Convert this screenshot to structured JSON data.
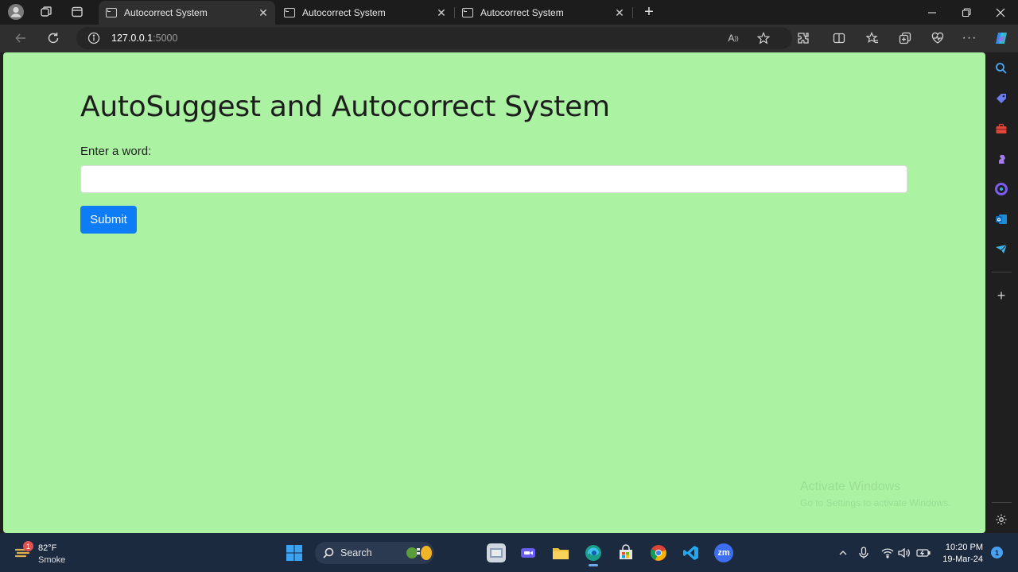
{
  "browser": {
    "tabs": [
      {
        "title": "Autocorrect System",
        "active": true
      },
      {
        "title": "Autocorrect System",
        "active": false
      },
      {
        "title": "Autocorrect System",
        "active": false
      }
    ],
    "url": {
      "host": "127.0.0.1",
      "port": ":5000"
    },
    "colors": {
      "tabbar": "#1c1c1c",
      "toolbar": "#2f2f2f",
      "page_bg": "#abf2a3"
    }
  },
  "page": {
    "heading": "AutoSuggest and Autocorrect System",
    "label": "Enter a word:",
    "input_value": "",
    "submit_label": "Submit",
    "submit_color": "#0d7cf5"
  },
  "watermark": {
    "line1": "Activate Windows",
    "line2": "Go to Settings to activate Windows."
  },
  "sidebar_icons": [
    "search-icon",
    "tag-icon",
    "toolbox-icon",
    "chess-icon",
    "copilot-icon",
    "outlook-icon",
    "send-icon",
    "add-icon",
    "settings-icon"
  ],
  "taskbar": {
    "weather": {
      "temp": "82°F",
      "condition": "Smoke",
      "badge": "1"
    },
    "search_label": "Search",
    "apps": [
      "file-explorer-icon",
      "edge-icon",
      "store-icon",
      "chrome-icon",
      "vscode-icon",
      "zoom-icon"
    ],
    "zoom_label": "zm",
    "clock": {
      "time": "10:20 PM",
      "date": "19-Mar-24"
    },
    "notification_count": "1"
  }
}
